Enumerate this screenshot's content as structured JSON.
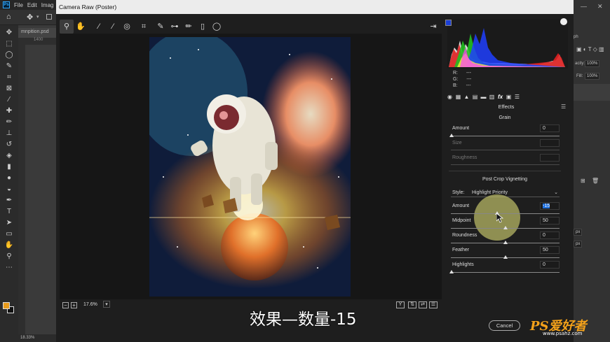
{
  "photoshop": {
    "menu": [
      "File",
      "Edit",
      "Imag"
    ],
    "doc_tab": "mnpition.psd",
    "ruler_tick": "1400",
    "status_zoom": "18.33%",
    "right_panel": {
      "tab_label": "ph",
      "opacity_label": "acity:",
      "opacity_value": "100%",
      "fill_label": "Fill:",
      "fill_value": "100%",
      "px1": "px",
      "px2": "px"
    },
    "foreground_color": "#e89b1c"
  },
  "camera_raw": {
    "window_title": "Camera Raw (Poster)",
    "toolbar_icons": [
      "zoom-icon",
      "hand-icon",
      "white-balance-icon",
      "color-sampler-icon",
      "targeted-adjustment-icon",
      "crop-icon",
      "spot-removal-icon",
      "red-eye-icon",
      "adjustment-brush-icon",
      "graduated-filter-icon",
      "radial-filter-icon"
    ],
    "zoom_value": "17.6%",
    "rgb_readout": [
      {
        "label": "R:",
        "value": "---"
      },
      {
        "label": "G:",
        "value": "---"
      },
      {
        "label": "B:",
        "value": "---"
      }
    ],
    "panel_title": "Effects",
    "grain": {
      "title": "Grain",
      "amount": {
        "label": "Amount",
        "value": "0"
      },
      "size": {
        "label": "Size",
        "value": ""
      },
      "roughness": {
        "label": "Roughness",
        "value": ""
      }
    },
    "vignetting": {
      "title": "Post Crop Vignetting",
      "style_label": "Style:",
      "style_value": "Highlight Priority",
      "amount": {
        "label": "Amount",
        "value": "-15"
      },
      "midpoint": {
        "label": "Midpoint",
        "value": "50"
      },
      "roundness": {
        "label": "Roundness",
        "value": "0"
      },
      "feather": {
        "label": "Feather",
        "value": "50"
      },
      "highlights": {
        "label": "Highlights",
        "value": "0"
      }
    },
    "cancel_label": "Cancel"
  },
  "subtitle": "效果—数量-15",
  "watermark": {
    "main": "PS爱好者",
    "sub": "www.psahz.com"
  }
}
